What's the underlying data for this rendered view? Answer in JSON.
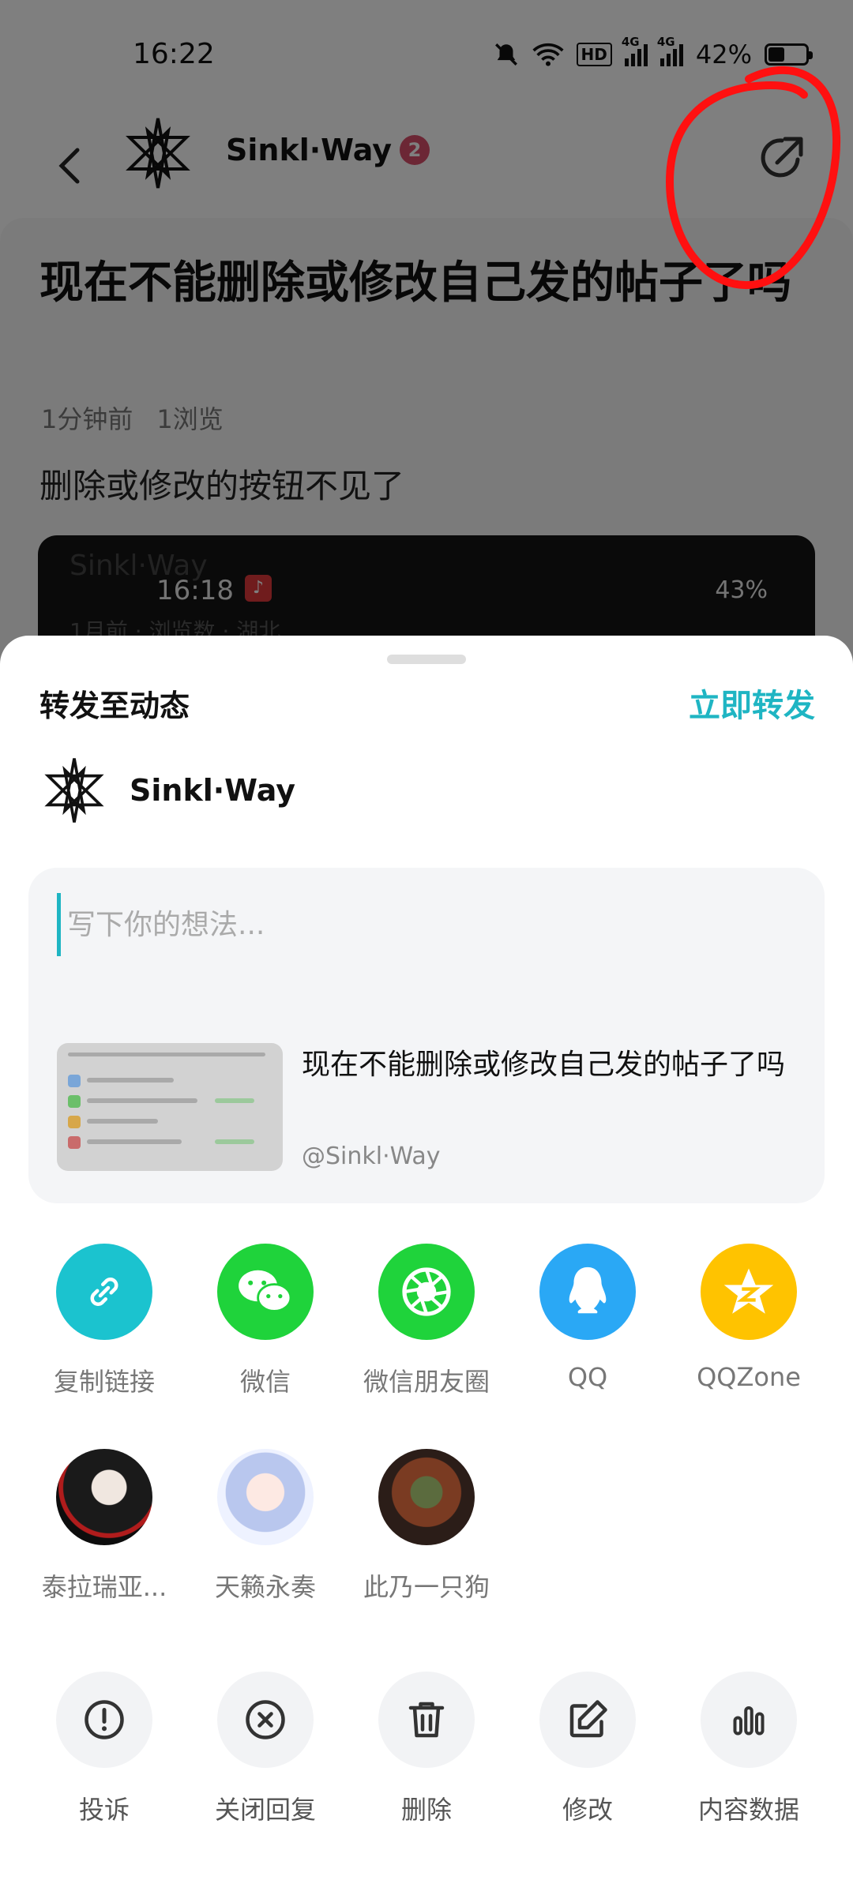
{
  "status_bar": {
    "time": "16:22",
    "battery": "42%",
    "hd": "HD",
    "net1": "4G",
    "net2": "4G"
  },
  "post": {
    "author": "Sinkl·Way",
    "level": "2",
    "title": "现在不能删除或修改自己发的帖子了吗",
    "meta_time": "1分钟前",
    "meta_views": "1浏览",
    "body": "删除或修改的按钮不见了",
    "screenshot": {
      "author": "Sinkl·Way",
      "time": "16:18",
      "battery": "43%",
      "meta": "1月前 · 浏览数 · 湖北"
    }
  },
  "sheet": {
    "title": "转发至动态",
    "repost_label": "立即转发",
    "user_name": "Sinkl·Way",
    "compose_placeholder": "写下你的想法...",
    "quote_title": "现在不能删除或修改自己发的帖子了吗",
    "quote_author": "@Sinkl·Way",
    "share_targets": [
      {
        "label": "复制链接",
        "icon": "link-icon",
        "color": "#1bc3cf"
      },
      {
        "label": "微信",
        "icon": "wechat-icon",
        "color": "#1fd33b"
      },
      {
        "label": "微信朋友圈",
        "icon": "moments-icon",
        "color": "#1fd33b"
      },
      {
        "label": "QQ",
        "icon": "qq-icon",
        "color": "#2aa8f5"
      },
      {
        "label": "QQZone",
        "icon": "qzone-icon",
        "color": "#ffc300"
      }
    ],
    "friends": [
      {
        "label": "泰拉瑞亚..."
      },
      {
        "label": "天籁永奏"
      },
      {
        "label": "此乃一只狗"
      }
    ],
    "actions": [
      {
        "label": "投诉",
        "icon": "alert-icon"
      },
      {
        "label": "关闭回复",
        "icon": "close-reply-icon"
      },
      {
        "label": "删除",
        "icon": "trash-icon"
      },
      {
        "label": "修改",
        "icon": "edit-icon"
      },
      {
        "label": "内容数据",
        "icon": "bar-chart-icon"
      }
    ]
  }
}
